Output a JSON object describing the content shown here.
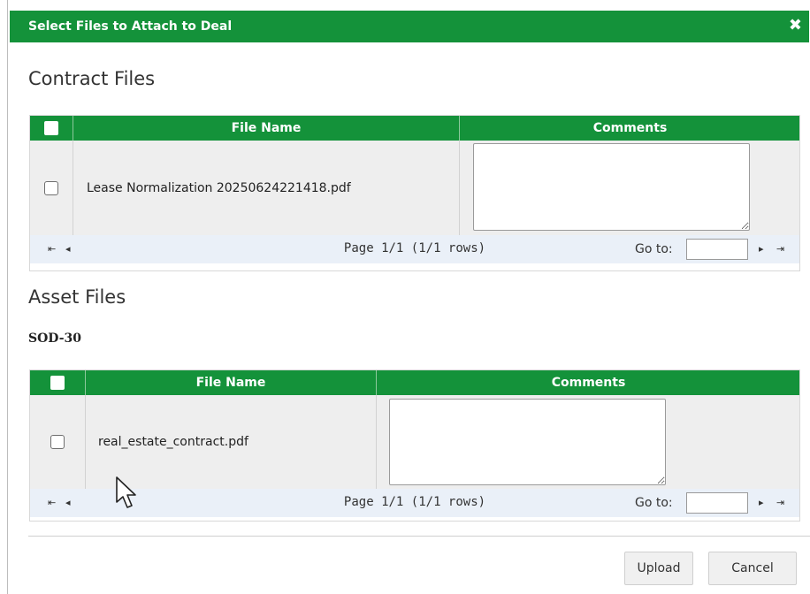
{
  "dialog": {
    "title": "Select Files to Attach to Deal",
    "close_icon": "close-icon",
    "close_glyph": "✖"
  },
  "contract_section": {
    "heading": "Contract Files",
    "columns": [
      "File Name",
      "Comments"
    ],
    "rows": [
      {
        "file_name": "Lease Normalization 20250624221418.pdf",
        "comment": "",
        "checked": false
      }
    ],
    "pager": {
      "info": "Page 1/1 (1/1 rows)",
      "goto_label": "Go to:",
      "goto_value": ""
    }
  },
  "asset_section": {
    "heading": "Asset Files",
    "asset_id": "SOD-30",
    "columns": [
      "File Name",
      "Comments"
    ],
    "rows": [
      {
        "file_name": "real_estate_contract.pdf",
        "comment": "",
        "checked": false
      }
    ],
    "pager": {
      "info": "Page 1/1 (1/1 rows)",
      "goto_label": "Go to:",
      "goto_value": ""
    }
  },
  "pager_icons": {
    "first": "⇤",
    "prev": "◂",
    "next": "▸",
    "last": "⇥"
  },
  "buttons": {
    "upload": "Upload",
    "cancel": "Cancel"
  },
  "colors": {
    "header_green": "#14923a",
    "row_background": "#eeeeee",
    "pager_background": "#eaf0f8"
  }
}
